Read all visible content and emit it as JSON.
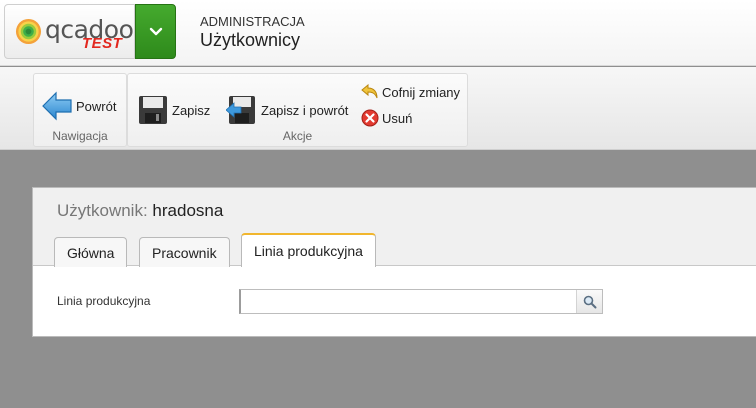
{
  "header": {
    "logo_text": "qcadoo",
    "logo_badge": "TEST",
    "section": "ADMINISTRACJA",
    "title": "Użytkownicy",
    "accent_color": "#3a9d23"
  },
  "ribbon": {
    "groups": [
      {
        "title": "Nawigacja",
        "items": [
          {
            "label": "Powrót",
            "icon": "back-arrow-icon"
          }
        ]
      },
      {
        "title": "Akcje",
        "items": [
          {
            "label": "Zapisz",
            "icon": "floppy-disk-icon"
          },
          {
            "label": "Zapisz i powrót",
            "icon": "save-and-back-icon"
          },
          {
            "label": "Cofnij zmiany",
            "icon": "undo-icon"
          },
          {
            "label": "Usuń",
            "icon": "delete-icon"
          }
        ]
      }
    ]
  },
  "form": {
    "entity_label": "Użytkownik:",
    "entity_value": "hradosna",
    "tabs": [
      {
        "label": "Główna",
        "active": false
      },
      {
        "label": "Pracownik",
        "active": false
      },
      {
        "label": "Linia produkcyjna",
        "active": true
      }
    ],
    "fields": [
      {
        "label": "Linia produkcyjna",
        "value": "",
        "icon": "search-icon"
      }
    ]
  }
}
